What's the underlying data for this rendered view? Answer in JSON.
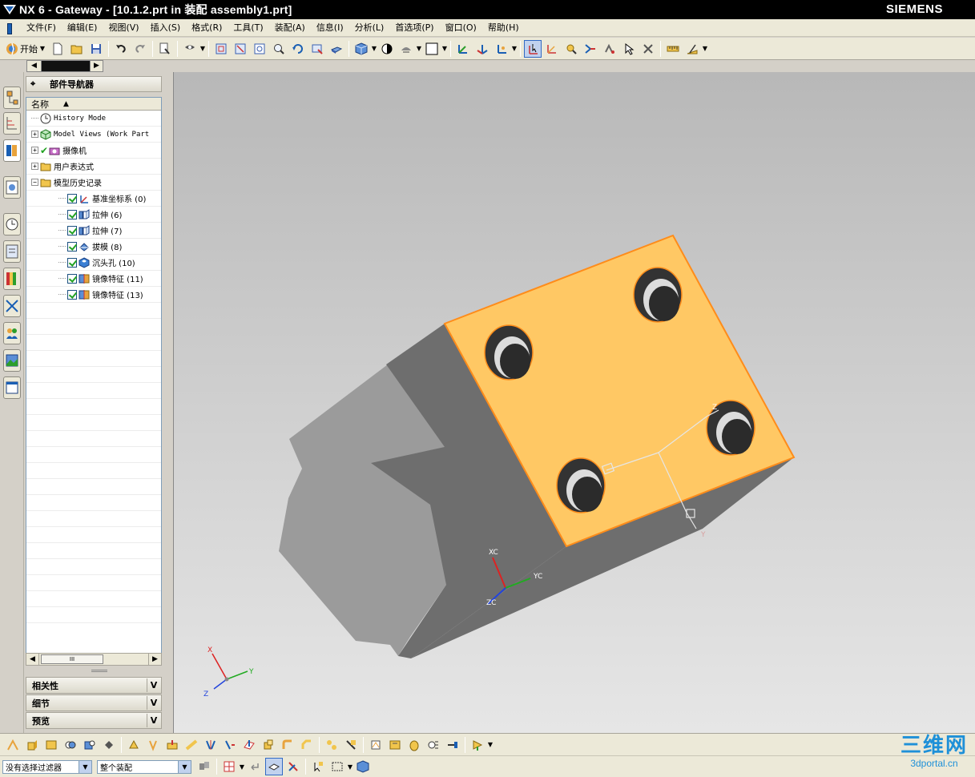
{
  "window": {
    "title": "NX 6 - Gateway - [10.1.2.prt in 装配 assembly1.prt]",
    "brand": "SIEMENS"
  },
  "menu": {
    "items": [
      {
        "label": "文件(F)"
      },
      {
        "label": "编辑(E)"
      },
      {
        "label": "视图(V)"
      },
      {
        "label": "插入(S)"
      },
      {
        "label": "格式(R)"
      },
      {
        "label": "工具(T)"
      },
      {
        "label": "装配(A)"
      },
      {
        "label": "信息(I)"
      },
      {
        "label": "分析(L)"
      },
      {
        "label": "首选项(P)"
      },
      {
        "label": "窗口(O)"
      },
      {
        "label": "帮助(H)"
      }
    ]
  },
  "toolbar": {
    "start_label": "开始"
  },
  "navigator": {
    "title": "部件导航器",
    "column_header": "名称",
    "items": [
      {
        "label": "History Mode",
        "icon": "clock-icon",
        "level": 0,
        "expander": "",
        "checked": false
      },
      {
        "label": "Model Views (Work Part",
        "icon": "model-views-icon",
        "level": 0,
        "expander": "+",
        "checked": false
      },
      {
        "label": "摄像机",
        "icon": "camera-icon",
        "level": 0,
        "expander": "+",
        "checked": true
      },
      {
        "label": "用户表达式",
        "icon": "folder-icon",
        "level": 0,
        "expander": "+",
        "checked": false
      },
      {
        "label": "模型历史记录",
        "icon": "folder-icon",
        "level": 0,
        "expander": "-",
        "checked": false
      },
      {
        "label": "基准坐标系 (0)",
        "icon": "datum-csys-icon",
        "level": 1,
        "expander": "",
        "checked": true
      },
      {
        "label": "拉伸 (6)",
        "icon": "extrude-icon",
        "level": 1,
        "expander": "",
        "checked": true
      },
      {
        "label": "拉伸 (7)",
        "icon": "extrude-icon",
        "level": 1,
        "expander": "",
        "checked": true
      },
      {
        "label": "拔模 (8)",
        "icon": "draft-icon",
        "level": 1,
        "expander": "",
        "checked": true
      },
      {
        "label": "沉头孔 (10)",
        "icon": "counterbore-hole-icon",
        "level": 1,
        "expander": "",
        "checked": true
      },
      {
        "label": "镜像特征 (11)",
        "icon": "mirror-feature-icon",
        "level": 1,
        "expander": "",
        "checked": true
      },
      {
        "label": "镜像特征 (13)",
        "icon": "mirror-feature-icon",
        "level": 1,
        "expander": "",
        "checked": true
      }
    ],
    "panels": [
      {
        "label": "相关性"
      },
      {
        "label": "细节"
      },
      {
        "label": "预览"
      }
    ],
    "scroll_thumb": "III"
  },
  "viewport": {
    "datum_labels": {
      "xc": "XC",
      "yc": "YC",
      "zc": "ZC"
    },
    "wcs_labels": {
      "x": "X",
      "y": "Y",
      "z": "Z"
    },
    "triad_labels": {
      "x": "X",
      "y": "Y",
      "z": "Z"
    },
    "colors": {
      "face_top": "#ffc864",
      "face_side": "#6e6e6e",
      "face_front": "#9b9b9b",
      "edge_highlight": "#ff8c1a"
    }
  },
  "status": {
    "filter": "没有选择过滤器",
    "scope": "整个装配"
  },
  "watermark": {
    "main": "三维网",
    "sub": "3dportal.cn"
  }
}
